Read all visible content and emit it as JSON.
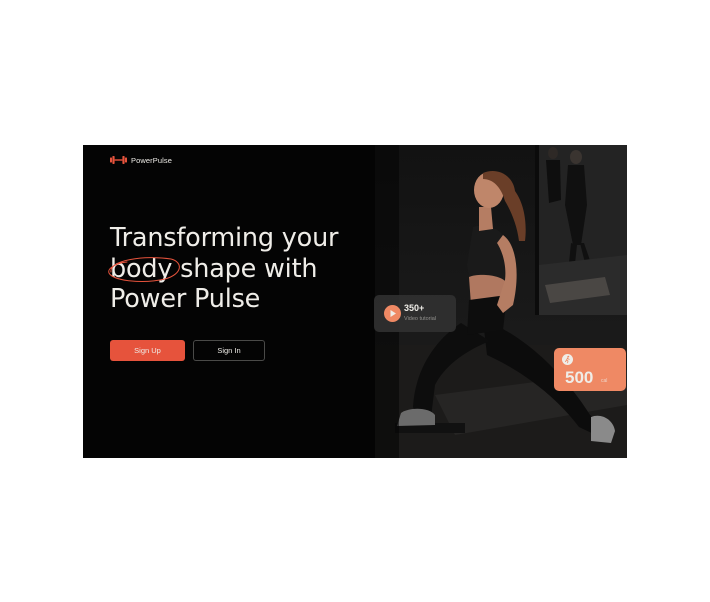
{
  "brand": {
    "name": "PowerPulse",
    "logo_icon": "dumbbell-icon",
    "accent_color": "#e6533c",
    "badge_color": "#ef8964"
  },
  "hero": {
    "headline_line1": "Transforming your",
    "headline_highlight": "body",
    "headline_line2_rest": "shape with",
    "headline_line3": "Power Pulse"
  },
  "buttons": {
    "sign_up": "Sign Up",
    "sign_in": "Sign In"
  },
  "video_badge": {
    "icon": "play-icon",
    "count": "350+",
    "label": "Video tutorial"
  },
  "calories_badge": {
    "icon": "running-icon",
    "value": "500",
    "unit": "cal"
  }
}
